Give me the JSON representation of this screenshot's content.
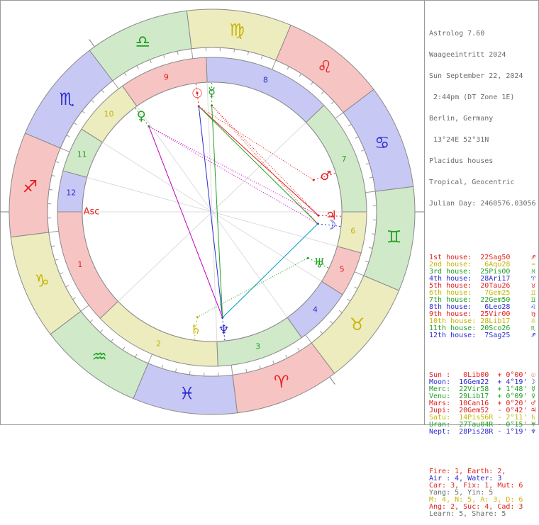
{
  "header": [
    "Astrolog 7.60",
    "Waageeintritt 2024",
    "Sun September 22, 2024",
    " 2:44pm (DT Zone 1E)",
    "Berlin, Germany",
    " 13°24E 52°31N",
    "Placidus houses",
    "Tropical, Geocentric",
    "Julian Day: 2460576.03056"
  ],
  "houses": [
    {
      "label": "1st house:  22Sag50",
      "glyph": "♐",
      "color": "#e3201e"
    },
    {
      "label": "2nd house:   6Aqu28",
      "glyph": "♒",
      "color": "#c8b400"
    },
    {
      "label": "3rd house:  25Pis00",
      "glyph": "♓",
      "color": "#22a022"
    },
    {
      "label": "4th house:  28Ari17",
      "glyph": "♈",
      "color": "#2b2bd0"
    },
    {
      "label": "5th house:  20Tau26",
      "glyph": "♉",
      "color": "#e3201e"
    },
    {
      "label": "6th house:   7Gem25",
      "glyph": "♊",
      "color": "#c8b400"
    },
    {
      "label": "7th house:  22Gem50",
      "glyph": "♊",
      "color": "#22a022"
    },
    {
      "label": "8th house:   6Leo28",
      "glyph": "♌",
      "color": "#2b2bd0"
    },
    {
      "label": "9th house:  25Vir00",
      "glyph": "♍",
      "color": "#e3201e"
    },
    {
      "label": "10th house: 28Lib17",
      "glyph": "♎",
      "color": "#c8b400"
    },
    {
      "label": "11th house: 20Sco26",
      "glyph": "♏",
      "color": "#22a022"
    },
    {
      "label": "12th house:  7Sag25",
      "glyph": "♐",
      "color": "#2b2bd0"
    }
  ],
  "planets": [
    {
      "label": "Sun :   0Lib00  + 0°00'",
      "glyph": "☉",
      "color": "#e3201e"
    },
    {
      "label": "Moon:  16Gem22  + 4°19'",
      "glyph": "☽",
      "color": "#2b2bd0"
    },
    {
      "label": "Merc:  22Vir58  + 1°48'",
      "glyph": "☿",
      "color": "#22a022"
    },
    {
      "label": "Venu:  29Lib17  + 0°09'",
      "glyph": "♀",
      "color": "#22a022"
    },
    {
      "label": "Mars:  10Can16  + 0°20'",
      "glyph": "♂",
      "color": "#e3201e"
    },
    {
      "label": "Jupi:  20Gem52  - 0°42'",
      "glyph": "♃",
      "color": "#e3201e"
    },
    {
      "label": "Satu:  14Pis56R - 2°11'",
      "glyph": "♄",
      "color": "#c8b400"
    },
    {
      "label": "Uran:  27Tau04R - 0°15'",
      "glyph": "♅",
      "color": "#22a022"
    },
    {
      "label": "Nept:  28Pis28R - 1°19'",
      "glyph": "♆",
      "color": "#2b2bd0"
    }
  ],
  "summary": [
    {
      "parts": [
        {
          "t": "Fire: 1, Earth: 2,",
          "c": "#e3201e"
        }
      ]
    },
    {
      "parts": [
        {
          "t": "Air : 4, Water: 3",
          "c": "#2b2bd0"
        }
      ]
    },
    {
      "parts": [
        {
          "t": "Car: 3, Fix: 1, Mut: 6",
          "c": "#e3201e"
        }
      ]
    },
    {
      "parts": [
        {
          "t": "Yang: 5, Yin: 5",
          "c": "#6b6b6b"
        }
      ]
    },
    {
      "parts": [
        {
          "t": "M: 4, N: 5, A: 3, D: 6",
          "c": "#c8b400"
        }
      ]
    },
    {
      "parts": [
        {
          "t": "Ang: 2, Suc: 4, Cad: 3",
          "c": "#e3201e"
        }
      ]
    },
    {
      "parts": [
        {
          "t": "Learn: 5, Share: 5",
          "c": "#6b6b6b"
        }
      ]
    }
  ],
  "chart": {
    "asc_label": "Asc",
    "zodiac": [
      {
        "glyph": "♒",
        "color": "#22a022",
        "fill": "#cfe9c9"
      },
      {
        "glyph": "♓",
        "color": "#2b2bd0",
        "fill": "#c8c8f5"
      },
      {
        "glyph": "♈",
        "color": "#e3201e",
        "fill": "#f7c4c4"
      },
      {
        "glyph": "♉",
        "color": "#c8b400",
        "fill": "#ececbf"
      },
      {
        "glyph": "♊",
        "color": "#22a022",
        "fill": "#cfe9c9"
      },
      {
        "glyph": "♋",
        "color": "#2b2bd0",
        "fill": "#c8c8f5"
      },
      {
        "glyph": "♌",
        "color": "#e3201e",
        "fill": "#f7c4c4"
      },
      {
        "glyph": "♍",
        "color": "#c8b400",
        "fill": "#ececbf"
      },
      {
        "glyph": "♎",
        "color": "#22a022",
        "fill": "#cfe9c9"
      },
      {
        "glyph": "♏",
        "color": "#2b2bd0",
        "fill": "#c8c8f5"
      },
      {
        "glyph": "♐",
        "color": "#e3201e",
        "fill": "#f7c4c4"
      },
      {
        "glyph": "♑",
        "color": "#c8b400",
        "fill": "#ececbf"
      }
    ],
    "house_numbers": [
      "1",
      "2",
      "3",
      "4",
      "5",
      "6",
      "7",
      "8",
      "9",
      "10",
      "11",
      "12"
    ],
    "house_cusps_deg": [
      262.83,
      306.47,
      355.0,
      28.28,
      50.43,
      67.42,
      82.83,
      126.47,
      175.0,
      208.28,
      230.43,
      247.42
    ],
    "planet_positions": [
      {
        "name": "sun",
        "lon": 180.0,
        "glyph": "☉",
        "color": "#e3201e"
      },
      {
        "name": "moon",
        "lon": 76.37,
        "glyph": "☽",
        "color": "#2b2bd0"
      },
      {
        "name": "mercury",
        "lon": 172.97,
        "glyph": "☿",
        "color": "#22a022"
      },
      {
        "name": "venus",
        "lon": 209.28,
        "glyph": "♀",
        "color": "#22a022"
      },
      {
        "name": "mars",
        "lon": 100.27,
        "glyph": "♂",
        "color": "#e3201e"
      },
      {
        "name": "jupiter",
        "lon": 80.87,
        "glyph": "♃",
        "color": "#e3201e"
      },
      {
        "name": "saturn",
        "lon": 344.93,
        "glyph": "♄",
        "color": "#c8b400"
      },
      {
        "name": "uranus",
        "lon": 57.07,
        "glyph": "♅",
        "color": "#22a022"
      },
      {
        "name": "neptune",
        "lon": 358.47,
        "glyph": "♆",
        "color": "#2b2bd0"
      }
    ],
    "aspects": [
      {
        "a": "sun",
        "b": "jupiter",
        "color": "#e3201e",
        "dash": false
      },
      {
        "a": "sun",
        "b": "neptune",
        "color": "#2b2bd0",
        "dash": false
      },
      {
        "a": "sun",
        "b": "moon",
        "color": "#22a022",
        "dash": false
      },
      {
        "a": "mercury",
        "b": "neptune",
        "color": "#22a022",
        "dash": false
      },
      {
        "a": "venus",
        "b": "neptune",
        "color": "#c000c0",
        "dash": false
      },
      {
        "a": "moon",
        "b": "neptune",
        "color": "#00a0c0",
        "dash": false
      },
      {
        "a": "venus",
        "b": "moon",
        "color": "#c000c0",
        "dash": true
      },
      {
        "a": "venus",
        "b": "jupiter",
        "color": "#c000c0",
        "dash": true
      },
      {
        "a": "sun",
        "b": "mars",
        "color": "#e3201e",
        "dash": true
      },
      {
        "a": "mercury",
        "b": "jupiter",
        "color": "#e3201e",
        "dash": true
      },
      {
        "a": "mercury",
        "b": "moon",
        "color": "#e3201e",
        "dash": true
      },
      {
        "a": "saturn",
        "b": "uranus",
        "color": "#22a022",
        "dash": true
      }
    ]
  }
}
